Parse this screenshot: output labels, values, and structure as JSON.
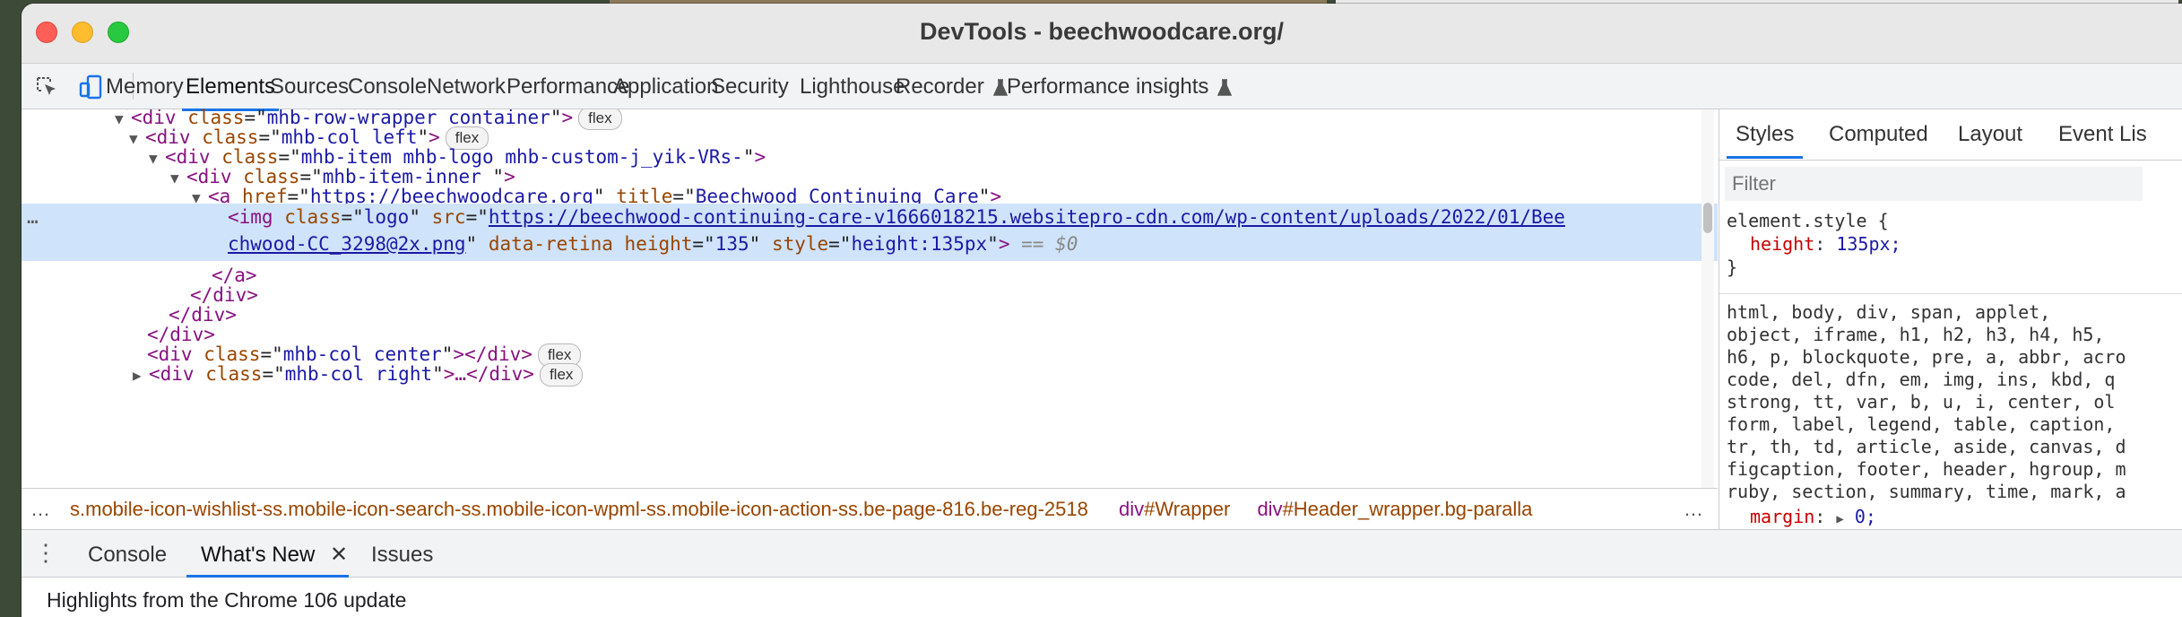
{
  "window": {
    "title": "DevTools - beechwoodcare.org/",
    "colors": {
      "close": "#ff5f57",
      "minimize": "#febc2e",
      "zoom": "#28c840",
      "accent": "#1a73e8"
    }
  },
  "toolbar": {
    "icons": [
      "inspect-element-icon",
      "device-toolbar-icon"
    ],
    "tabs": [
      "Memory",
      "Elements",
      "Sources",
      "Console",
      "Network",
      "Performance",
      "Application",
      "Security",
      "Lighthouse",
      "Recorder",
      "Performance insights"
    ],
    "active_tab": "Elements"
  },
  "elements": {
    "lines": [
      {
        "open": "<div",
        "attrs": [
          {
            "name": "class",
            "value": "mhb-row-wrapper container"
          }
        ],
        "close": ">",
        "badge": "flex"
      },
      {
        "open": "<div",
        "attrs": [
          {
            "name": "class",
            "value": "mhb-col left"
          }
        ],
        "close": ">",
        "badge": "flex"
      },
      {
        "open": "<div",
        "attrs": [
          {
            "name": "class",
            "value": "mhb-item mhb-logo mhb-custom-j_yik-VRs-"
          }
        ],
        "close": ">"
      },
      {
        "open": "<div",
        "attrs": [
          {
            "name": "class",
            "value": "mhb-item-inner "
          }
        ],
        "close": ">"
      },
      {
        "open": "<a",
        "href": "https://beechwoodcare.org",
        "title_attr": "Beechwood Continuing Care",
        "close": ">"
      }
    ],
    "selected": {
      "tag_open": "<img",
      "class_value": "logo",
      "src_line1": "https://beechwood-continuing-care-v1666018215.websitepro-cdn.com/wp-content/uploads/2022/01/Bee",
      "src_line2": "chwood-CC_3298@2x.png",
      "data_retina": "data-retina",
      "height": "135",
      "style": "height:135px",
      "marker": "== $0"
    },
    "closing": [
      "</a>",
      "</div>",
      "</div>",
      "</div>"
    ],
    "center_div": {
      "class": "mhb-col center",
      "badge": "flex"
    },
    "right_div": {
      "class": "mhb-col right",
      "badge": "flex"
    }
  },
  "breadcrumb": {
    "body_classes": "s.mobile-icon-wishlist-ss.mobile-icon-search-ss.mobile-icon-wpml-ss.mobile-icon-action-ss.be-page-816.be-reg-2518",
    "items": [
      {
        "tag": "div",
        "rest": "#Wrapper"
      },
      {
        "tag": "div",
        "rest": "#Header_wrapper.bg-paralla"
      }
    ]
  },
  "styles": {
    "tabs": [
      "Styles",
      "Computed",
      "Layout",
      "Event Lis"
    ],
    "active_tab": "Styles",
    "filter_placeholder": "Filter",
    "element_style": {
      "selector": "element.style {",
      "prop": "height",
      "value": "135px;",
      "close": "}"
    },
    "reset_rule_lines": [
      "html, body, div, span, applet,",
      "object, iframe, h1, h2, h3, h4, h5,",
      "h6, p, blockquote, pre, a, abbr, acro",
      "code, del, dfn, em, img, ins, kbd, q",
      "strong, tt, var, b, u, i, center, ol",
      "form, label, legend, table, caption,",
      "tr, th, td, article, aside, canvas, d",
      "figcaption, footer, header, hgroup, m",
      "ruby, section, summary, time, mark, a"
    ],
    "margin": {
      "prop": "margin",
      "value": "0;"
    }
  },
  "drawer": {
    "tabs": [
      "Console",
      "What's New",
      "Issues"
    ],
    "active_tab": "What's New",
    "content": "Highlights from the Chrome 106 update"
  }
}
